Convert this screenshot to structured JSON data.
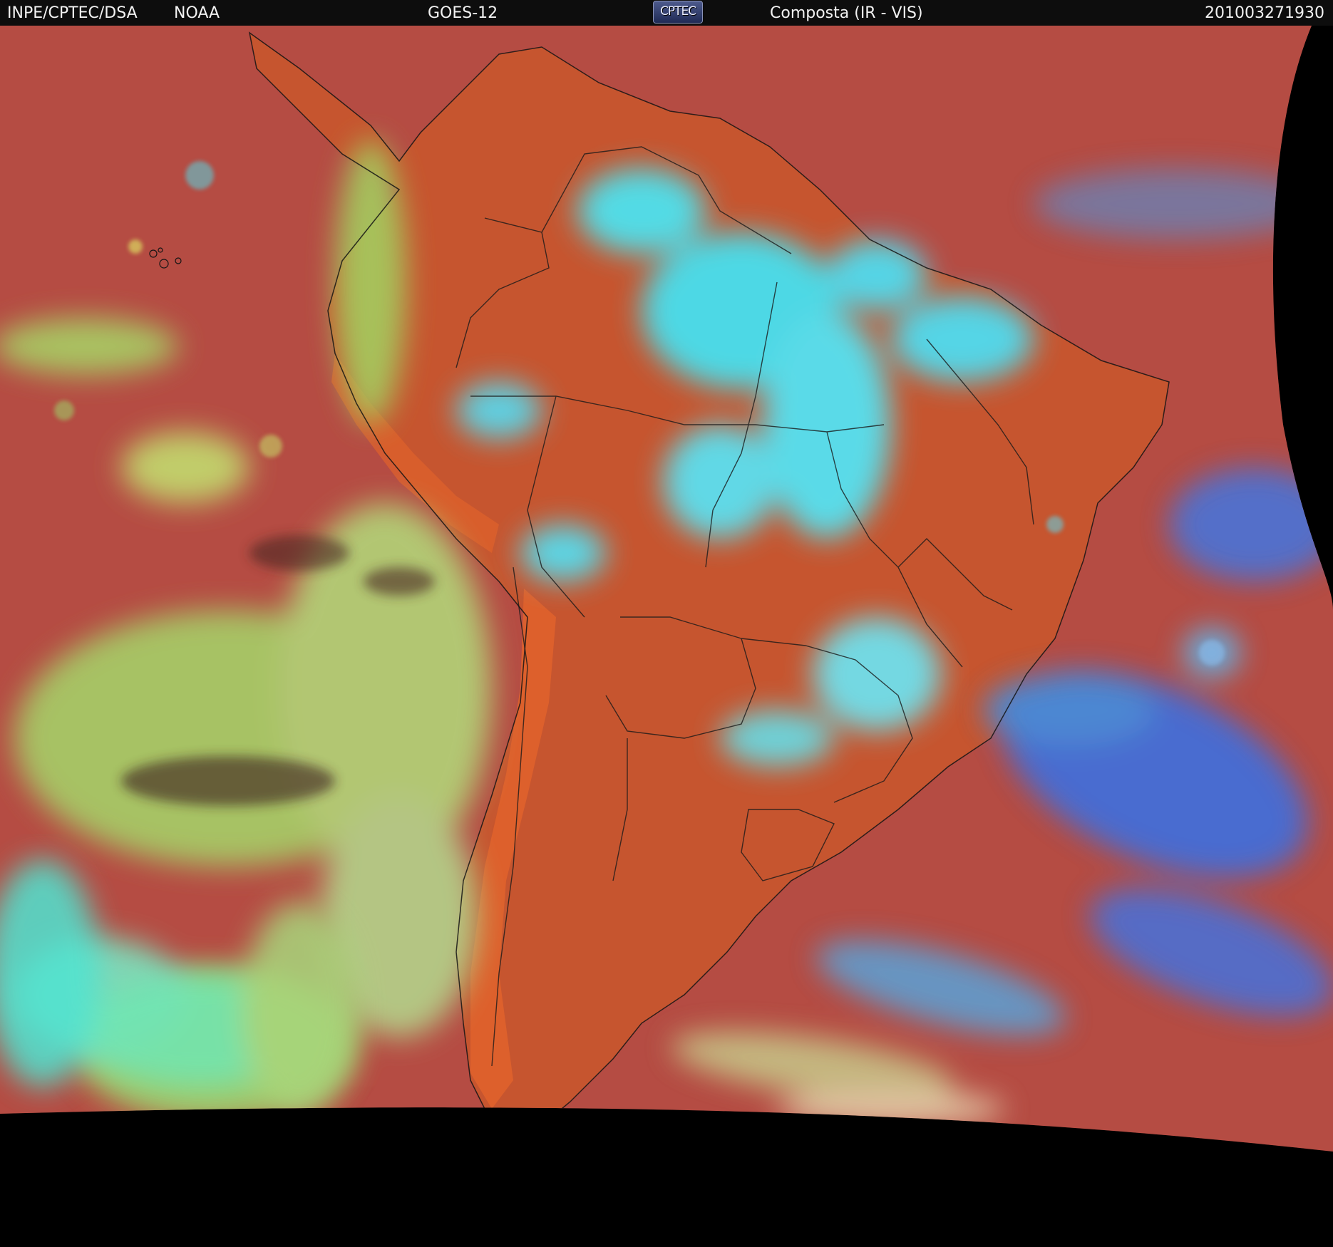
{
  "header": {
    "agency": "INPE/CPTEC/DSA",
    "provider": "NOAA",
    "satellite": "GOES-12",
    "logo_text": "CPTEC",
    "product": "Composta (IR - VIS)",
    "timestamp": "201003271930"
  },
  "colors": {
    "ocean_red": "#b04a46",
    "land_orange": "#c8572f",
    "cloud_cyan": "#3fe3ee",
    "cloud_green": "#9ed86a",
    "cloud_blue": "#3d74e0",
    "space": "#000000"
  },
  "icons": {
    "logo": "cptec-logo"
  }
}
